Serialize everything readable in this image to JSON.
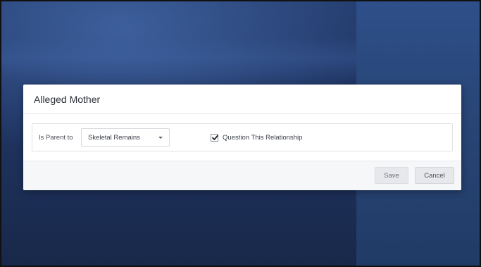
{
  "dialog": {
    "title": "Alleged Mother",
    "relationship_label": "Is Parent to",
    "relationship_select": {
      "selected": "Skeletal Remains"
    },
    "question_checkbox": {
      "label": "Question This Relationship",
      "checked": true
    },
    "save_label": "Save",
    "cancel_label": "Cancel"
  },
  "colors": {
    "background_left": "#1f3461",
    "background_right": "#284677",
    "dialog_bg": "#ffffff",
    "footer_bg": "#f5f7f9",
    "button_bg": "#e6e8eb"
  }
}
